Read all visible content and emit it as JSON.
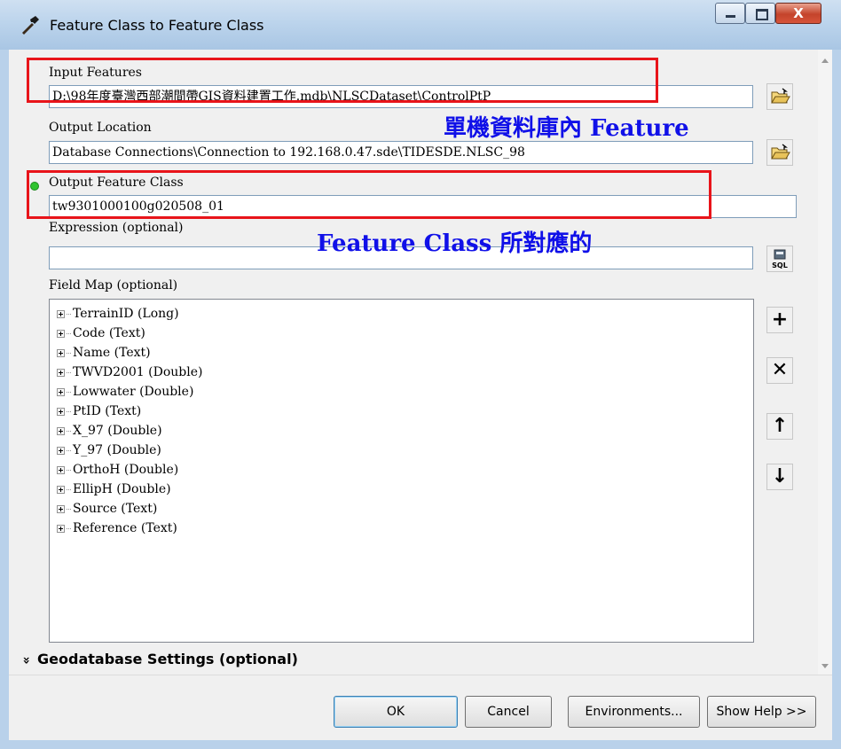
{
  "window": {
    "title": "Feature Class to Feature Class",
    "close_glyph": "X"
  },
  "form": {
    "input_features": {
      "label": "Input Features",
      "value": "D:\\98年度臺灣西部潮間帶GIS資料建置工作.mdb\\NLSCDataset\\ControlPtP"
    },
    "output_location": {
      "label": "Output Location",
      "value": "Database Connections\\Connection to 192.168.0.47.sde\\TIDESDE.NLSC_98"
    },
    "output_feature_class": {
      "label": "Output Feature Class",
      "value": "tw9301000100g020508_01"
    },
    "expression": {
      "label": "Expression (optional)",
      "value": ""
    },
    "field_map": {
      "label": "Field Map (optional)",
      "items": [
        "TerrainID (Long)",
        "Code (Text)",
        "Name (Text)",
        "TWVD2001 (Double)",
        "Lowwater (Double)",
        "PtID (Text)",
        "X_97 (Double)",
        "Y_97 (Double)",
        "OrthoH (Double)",
        "EllipH (Double)",
        "Source (Text)",
        "Reference (Text)"
      ]
    },
    "geodatabase_settings": {
      "chevron": "»",
      "label": "Geodatabase Settings (optional)"
    }
  },
  "annotations": {
    "note1": "單機資料庫內 Feature",
    "note2": "Feature Class 所對應的"
  },
  "side_buttons": {
    "add": "+",
    "delete": "✕",
    "up": "↑",
    "down": "↓"
  },
  "buttons": {
    "ok": "OK",
    "cancel": "Cancel",
    "environments": "Environments...",
    "show_help": "Show Help >>"
  },
  "colors": {
    "highlight_box": "#e8141a",
    "annotation_text": "#1010e8",
    "required_dot": "#2fc42f"
  },
  "icons": {
    "app": "hammer-icon",
    "browse": "open-folder-icon",
    "sql": "sql-query-icon"
  }
}
